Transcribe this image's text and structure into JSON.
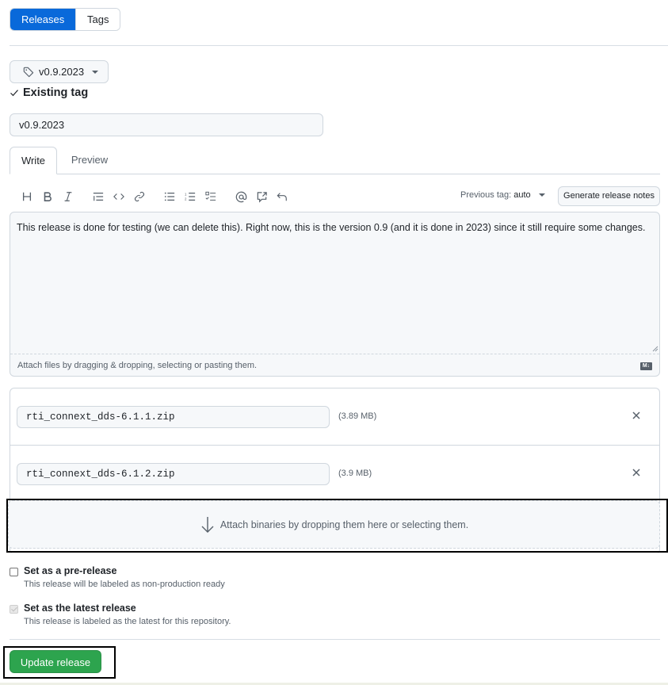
{
  "nav": {
    "tabs": [
      {
        "label": "Releases",
        "active": true
      },
      {
        "label": "Tags",
        "active": false
      }
    ]
  },
  "tag_picker": {
    "value": "v0.9.2023",
    "icon": "tag-icon",
    "status": "Existing tag"
  },
  "release_title": {
    "value": "v0.9.2023"
  },
  "editor": {
    "tabs": [
      {
        "label": "Write",
        "active": true
      },
      {
        "label": "Preview",
        "active": false
      }
    ],
    "toolbar": [
      "heading-icon",
      "bold-icon",
      "italic-icon",
      "quote-icon",
      "code-icon",
      "link-icon",
      "unordered-list-icon",
      "ordered-list-icon",
      "task-list-icon",
      "mention-icon",
      "cross-reference-icon",
      "undo-icon"
    ],
    "previous_tag_label": "Previous tag:",
    "previous_tag_value": "auto",
    "generate_notes_label": "Generate release notes",
    "body": "This release is done for testing (we can delete this). Right now, this is the version 0.9 (and it is done in 2023) since it still require some changes.",
    "attach_hint": "Attach files by dragging & dropping, selecting or pasting them.",
    "markdown_badge": "M↓"
  },
  "assets": [
    {
      "name": "rti_connext_dds-6.1.1.zip",
      "size": "(3.89 MB)"
    },
    {
      "name": "rti_connext_dds-6.1.2.zip",
      "size": "(3.9 MB)"
    }
  ],
  "dropzone": {
    "label": "Attach binaries by dropping them here or selecting them."
  },
  "options": [
    {
      "title": "Set as a pre-release",
      "description": "This release will be labeled as non-production ready",
      "checked": false,
      "disabled": false
    },
    {
      "title": "Set as the latest release",
      "description": "This release is labeled as the latest for this repository.",
      "checked": true,
      "disabled": true
    }
  ],
  "submit": {
    "label": "Update release",
    "color": "#2da44e"
  },
  "colors": {
    "accent": "#0969da",
    "border": "#d0d7de",
    "muted_text": "#57606a",
    "input_bg": "#f6f8fa"
  }
}
